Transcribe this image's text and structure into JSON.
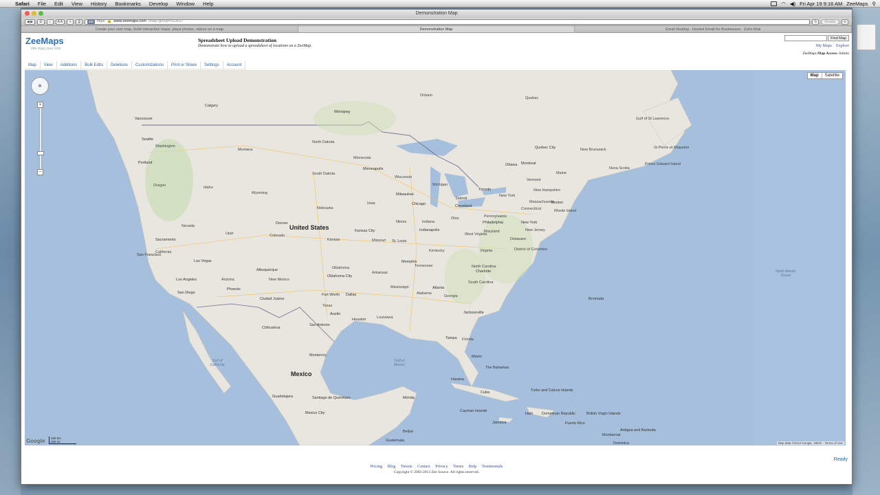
{
  "menubar": {
    "app": "Safari",
    "items": [
      "File",
      "Edit",
      "View",
      "History",
      "Bookmarks",
      "Develop",
      "Window",
      "Help"
    ],
    "clock": "Fri Apr 19  9:16 AM",
    "user": "ZeeMaps"
  },
  "window": {
    "title": "Demonstration Map",
    "url_badge": "ZM",
    "url_scheme": "https",
    "url_host": "www.zeemaps.com",
    "url_path": "/map?group=533627",
    "reader_label": "Reader"
  },
  "bookmarks": [
    "Create your own map, build interactive maps, place photos, videos on a map",
    "Demonstration Map",
    "Email Hosting · Hosted Email for Businesses · Zoho Mail"
  ],
  "header": {
    "logo": "ZeeMaps",
    "tagline": "We map your lists",
    "map_title": "Spreadsheet Upload Demonstration",
    "map_description": "Demonstrate how to upload a spreadsheet of locations on a ZeeMap.",
    "find_button": "Find Map",
    "my_maps": "My Maps",
    "explore": "Explore",
    "access_prefix": "ZeeMaps",
    "access_label": "Map Access:",
    "access_value": "Admin"
  },
  "nav": [
    "Map",
    "View",
    "Additions",
    "Bulk Edits",
    "Deletions",
    "Customizations",
    "Print or Share",
    "Settings",
    "Account"
  ],
  "map": {
    "type_map": "Map",
    "type_satellite": "Satellite",
    "scale_km": "200 km",
    "scale_mi": "200 mi",
    "google": "Google",
    "attribution": "Map data ©2013 Google, INEGI - Terms of Use",
    "countries": {
      "us": "United States",
      "mexico": "Mexico"
    },
    "ocean": "North Atlantic Ocean",
    "gulf_ca": "Gulf of California",
    "gulf_mx": "Gulf of Mexico",
    "states": [
      "Washington",
      "Oregon",
      "Idaho",
      "Montana",
      "Wyoming",
      "Nevada",
      "California",
      "Utah",
      "Colorado",
      "Arizona",
      "New Mexico",
      "North Dakota",
      "South Dakota",
      "Nebraska",
      "Kansas",
      "Oklahoma",
      "Texas",
      "Minnesota",
      "Iowa",
      "Missouri",
      "Arkansas",
      "Louisiana",
      "Wisconsin",
      "Illinois",
      "Michigan",
      "Indiana",
      "Ohio",
      "Kentucky",
      "Tennessee",
      "Mississippi",
      "Alabama",
      "Georgia",
      "Florida",
      "South Carolina",
      "North Carolina",
      "Virginia",
      "West Virginia",
      "Pennsylvania",
      "New York",
      "Maine",
      "Vermont",
      "New Hampshire",
      "Massachusetts",
      "Connecticut",
      "New Jersey",
      "Maryland",
      "Delaware",
      "Rhode Island",
      "District of Columbia",
      "Ontario",
      "Quebec",
      "New Brunswick",
      "Nova Scotia",
      "Prince Edward Island",
      "St Pierre et Miquelon",
      "Gulf of St Lawrence"
    ],
    "cities": [
      "Calgary",
      "Vancouver",
      "Seattle",
      "Portland",
      "Winnipeg",
      "Minneapolis",
      "Milwaukee",
      "Detroit",
      "Chicago",
      "Cleveland",
      "Toronto",
      "Ottawa",
      "Montreal",
      "Quebec City",
      "Boston",
      "New York",
      "Philadelphia",
      "Denver",
      "Sacramento",
      "San Francisco",
      "Las Vegas",
      "Los Angeles",
      "San Diego",
      "Phoenix",
      "Albuquerque",
      "Kansas City",
      "St. Louis",
      "Indianapolis",
      "Memphis",
      "Oklahoma City",
      "Dallas",
      "Fort Worth",
      "Austin",
      "San Antonio",
      "Houston",
      "Atlanta",
      "Charlotte",
      "Jacksonville",
      "Tampa",
      "Miami",
      "Ciudad Juárez",
      "Chihuahua",
      "Monterrey",
      "Guadalajara",
      "Mexico City",
      "Santiago de Querétaro",
      "Mérida",
      "Guatemala",
      "Belize",
      "Havana",
      "Cuba",
      "The Bahamas",
      "Turks and Caicos Islands",
      "Jamaica",
      "Haiti",
      "Dominican Republic",
      "Puerto Rico",
      "British Virgin Islands",
      "Antigua and Barbuda",
      "Cayman Islands",
      "Montserrat",
      "Dominica",
      "Bermuda"
    ]
  },
  "footer": {
    "ready": "Ready",
    "links": [
      "Pricing",
      "Blog",
      "Tweets",
      "Contact",
      "Privacy",
      "Terms",
      "Help",
      "Testimonials"
    ],
    "copyright": "Copyright © 2005-2013 Zee Source. All rights reserved."
  }
}
